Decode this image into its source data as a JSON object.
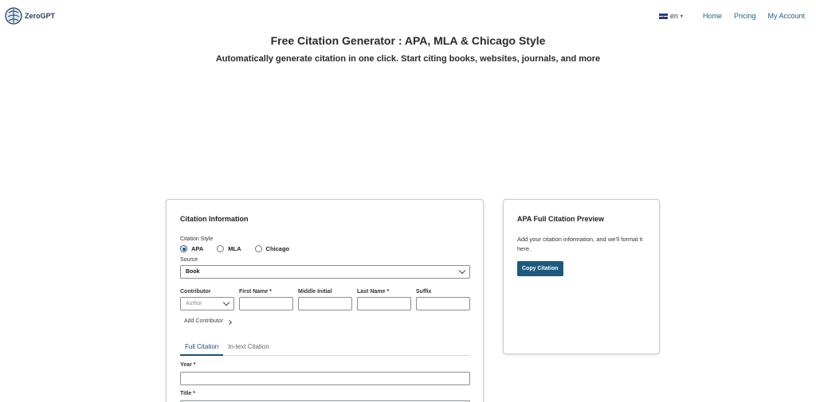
{
  "header": {
    "logo_text": "ZeroGPT",
    "language": "en",
    "nav": [
      "Home",
      "Pricing",
      "My Account"
    ]
  },
  "page": {
    "title": "Free Citation Generator : APA, MLA & Chicago Style",
    "subtitle": "Automatically generate citation in one click. Start citing books, websites, journals, and more"
  },
  "citation_form": {
    "title": "Citation Information",
    "style_label": "Citation Style",
    "styles": [
      "APA",
      "MLA",
      "Chicago"
    ],
    "selected_style": "APA",
    "source_label": "Source",
    "source_value": "Book",
    "contributor": {
      "label": "Contributor",
      "role_placeholder": "Author",
      "first_name_label": "First Name *",
      "middle_initial_label": "Middle Initial",
      "last_name_label": "Last Name *",
      "suffix_label": "Suffix",
      "add_label": "Add Contributor"
    },
    "tabs": [
      "Full Citation",
      "In-text Citation"
    ],
    "active_tab": "Full Citation",
    "year_label": "Year *",
    "title_label": "Title *"
  },
  "preview": {
    "title": "APA Full Citation Preview",
    "text": "Add your citation information, and we'll format it here.",
    "copy_button": "Copy Citation"
  },
  "colors": {
    "accent": "#1b5a7e",
    "nav_link": "#1f5f86"
  }
}
